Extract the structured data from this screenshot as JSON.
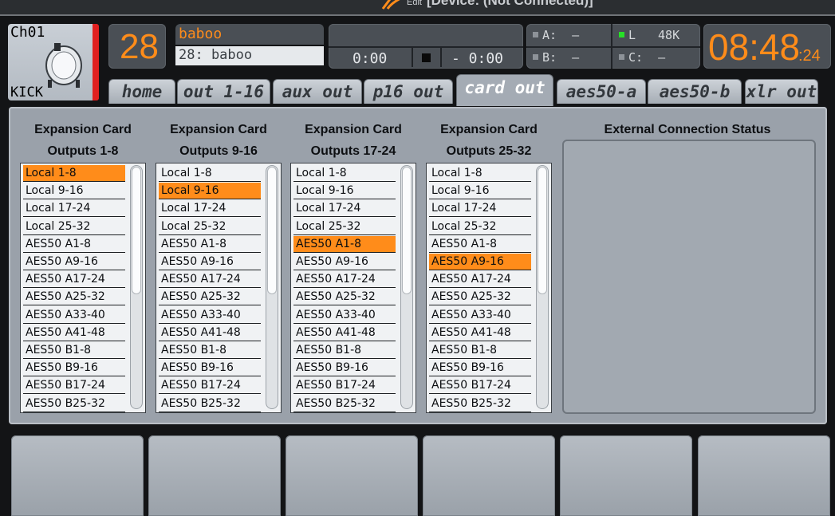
{
  "window": {
    "title_prefix": "Edit",
    "title": "[Device: (Not Connected)]"
  },
  "channel": {
    "number": "Ch01",
    "name": "KICK",
    "icon": "kick-drum-icon",
    "strip_color": "#e02020"
  },
  "header": {
    "big_number": "28",
    "name_top": "baboo",
    "name_bottom": "28: baboo",
    "transport": {
      "time_elapsed": "0:00",
      "time_remaining": "- 0:00",
      "stop_icon": "stop-icon"
    },
    "status": {
      "a": "A:",
      "a_val": "–",
      "b": "B:",
      "b_val": "–",
      "l": "L",
      "l_val": "48K",
      "c": "C:",
      "c_val": "–"
    },
    "clock_hm": "08:48",
    "clock_sec": ":24",
    "accent_color": "#ff8c1a"
  },
  "tabs": [
    {
      "label": "home"
    },
    {
      "label": "out 1-16"
    },
    {
      "label": "aux out"
    },
    {
      "label": "p16 out"
    },
    {
      "label": "card out",
      "active": true
    },
    {
      "label": "aes50-a"
    },
    {
      "label": "aes50-b"
    },
    {
      "label": "xlr out"
    }
  ],
  "columns": [
    {
      "head1": "Expansion Card",
      "head2": "Outputs 1-8",
      "selected": 0
    },
    {
      "head1": "Expansion Card",
      "head2": "Outputs 9-16",
      "selected": 1
    },
    {
      "head1": "Expansion Card",
      "head2": "Outputs 17-24",
      "selected": 4
    },
    {
      "head1": "Expansion Card",
      "head2": "Outputs 25-32",
      "selected": 5
    }
  ],
  "list_options": [
    "Local 1-8",
    "Local 9-16",
    "Local 17-24",
    "Local 25-32",
    "AES50 A1-8",
    "AES50 A9-16",
    "AES50 A17-24",
    "AES50 A25-32",
    "AES50 A33-40",
    "AES50 A41-48",
    "AES50 B1-8",
    "AES50 B9-16",
    "AES50 B17-24",
    "AES50 B25-32"
  ],
  "external": {
    "title": "External Connection Status"
  }
}
